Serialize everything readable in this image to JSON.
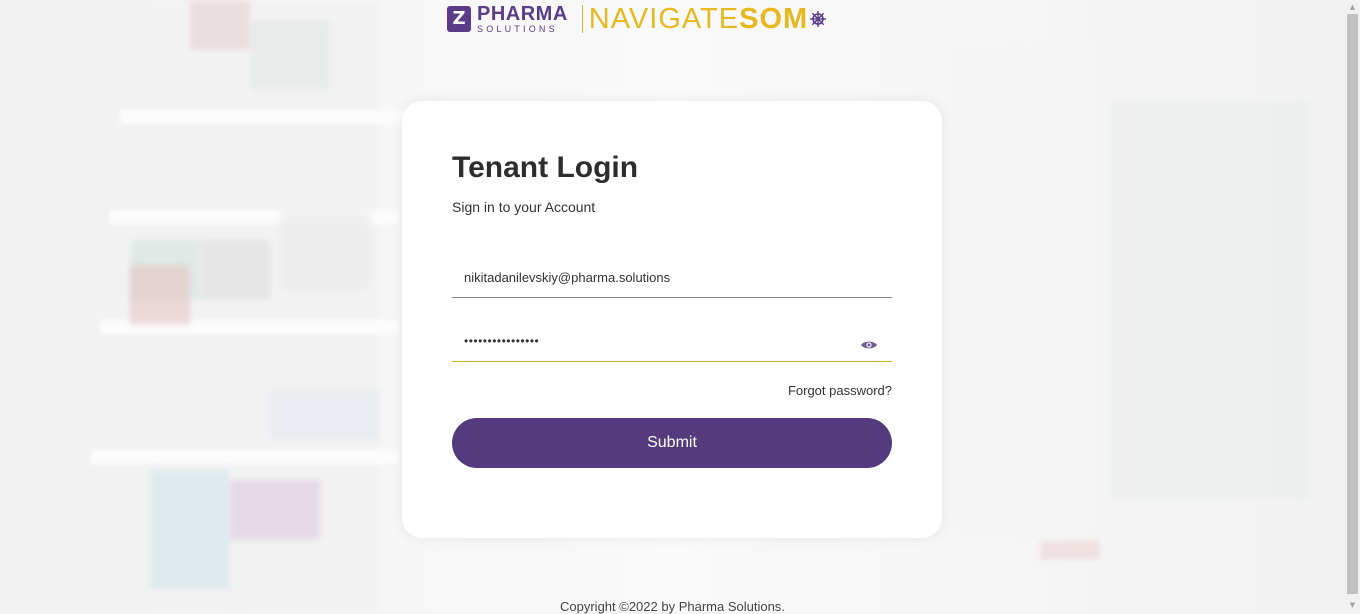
{
  "logo": {
    "brand_big": "PHARMA",
    "brand_small": "SOLUTIONS",
    "product_light": "NAVIGATE",
    "product_bold": "SOM",
    "brand_color": "#5b3c88",
    "accent_color": "#e8b820"
  },
  "login": {
    "title": "Tenant Login",
    "subtitle": "Sign in to your Account",
    "email_value": "nikitadanilevskiy@pharma.solutions",
    "password_value": "••••••••••••••••",
    "show_password_icon": "eye-icon",
    "forgot_label": "Forgot password?",
    "submit_label": "Submit",
    "submit_color": "#533b7e"
  },
  "footer": {
    "copyright": "Copyright ©2022 by Pharma Solutions."
  }
}
